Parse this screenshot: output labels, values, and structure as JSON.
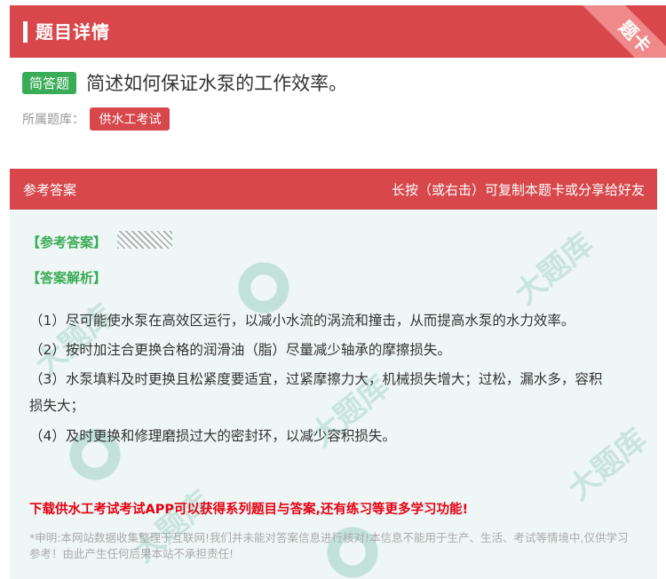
{
  "header": {
    "title": "题目详情",
    "ribbon": "题卡"
  },
  "question": {
    "type_tag": "简答题",
    "text": "简述如何保证水泵的工作效率。",
    "bank_label": "所属题库：",
    "bank_name": "供水工考试"
  },
  "answer_bar": {
    "left": "参考答案",
    "right": "长按（或右击）可复制本题卡或分享给好友"
  },
  "answer": {
    "ref_label": "【参考答案】",
    "analysis_label": "【答案解析】",
    "lines": [
      "（1）尽可能使水泵在高效区运行，以减小水流的涡流和撞击，从而提高水泵的水力效率。",
      "（2）按时加注合更换合格的润滑油（脂）尽量减少轴承的摩擦损失。",
      "（3）水泵填料及时更换且松紧度要适宜，过紧摩擦力大，机械损失增大；过松，漏水多，容积",
      "损失大；",
      "（4）及时更换和修理磨损过大的密封环，以减少容积损失。"
    ]
  },
  "promo": "下载供水工考试考试APP可以获得系列题目与答案,还有练习等更多学习功能!",
  "disclaimer": "*申明:本网站数据收集整理于互联网!我们并未能对答案信息进行核对!本信息不能用于生产、生活、考试等情境中,仅供学习参考！由此产生任何后果本站不承担责任!",
  "colors": {
    "primary_red": "#d7474b",
    "green": "#3aab57",
    "answer_bg": "#eef7f5",
    "promo_red": "#e60012"
  }
}
